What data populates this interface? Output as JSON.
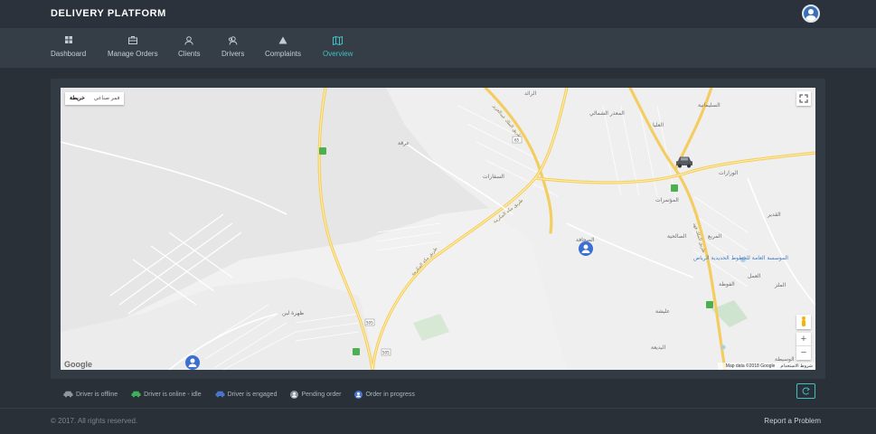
{
  "brand": {
    "title": "DELIVERY PLATFORM"
  },
  "user": {
    "avatar_icon": "user-icon"
  },
  "nav": [
    {
      "label": "Dashboard",
      "icon": "dashboard-icon",
      "active": false
    },
    {
      "label": "Manage Orders",
      "icon": "briefcase-icon",
      "active": false
    },
    {
      "label": "Clients",
      "icon": "user-icon",
      "active": false
    },
    {
      "label": "Drivers",
      "icon": "users-icon",
      "active": false
    },
    {
      "label": "Complaints",
      "icon": "warning-icon",
      "active": false
    },
    {
      "label": "Overview",
      "icon": "map-icon",
      "active": true
    }
  ],
  "map": {
    "type_options": [
      "خريطة",
      "قمر صناعي"
    ],
    "selected_type": "خريطة",
    "logo": "Google",
    "map_data": "Map data ©2018 Google",
    "terms": "شروط الاستخدام",
    "zoom_in": "+",
    "zoom_out": "−",
    "place_labels": {
      "a": "عرقة",
      "b": "ظهرة لبن",
      "c": "السفارات",
      "d": "المربع",
      "e": "الوزارات",
      "f": "القدير",
      "g": "الرائد",
      "h": "المعذر الشمالي",
      "i": "العليا",
      "j": "السليمانية",
      "k": "المؤتمرات",
      "l": "الموسسة العامة للخطوط الحديدية الرياض",
      "m": "الملز",
      "n": "الصالحية",
      "o": "البديعة",
      "p": "عليشة",
      "q": "العمل",
      "r": "الفوطة",
      "s": "الوسيطة",
      "t": "الصحافة"
    },
    "road_labels": {
      "a": "طريق مكة المكرمة",
      "b": "طريق مكة المكرمة",
      "c": "طريق الملك فهد",
      "d": "طريق الملك عبدالعزيز"
    },
    "shields": [
      "505",
      "505",
      "65"
    ]
  },
  "legend": [
    {
      "label": "Driver is offline",
      "icon": "car-icon",
      "color": "#8c96a1"
    },
    {
      "label": "Driver is online - idle",
      "icon": "car-icon",
      "color": "#3fae5a"
    },
    {
      "label": "Driver is engaged",
      "icon": "car-icon",
      "color": "#4a74c9"
    },
    {
      "label": "Pending order",
      "icon": "user-icon",
      "color": "#8c96a1"
    },
    {
      "label": "Order in progress",
      "icon": "user-icon",
      "color": "#4a74c9"
    }
  ],
  "refresh": {
    "icon": "refresh-icon"
  },
  "footer": {
    "copyright": "© 2017. All rights reserved.",
    "report": "Report a Problem"
  },
  "colors": {
    "accent": "#41bfc4",
    "order_marker": "#3b6fd1",
    "offline_car": "#555a60"
  }
}
